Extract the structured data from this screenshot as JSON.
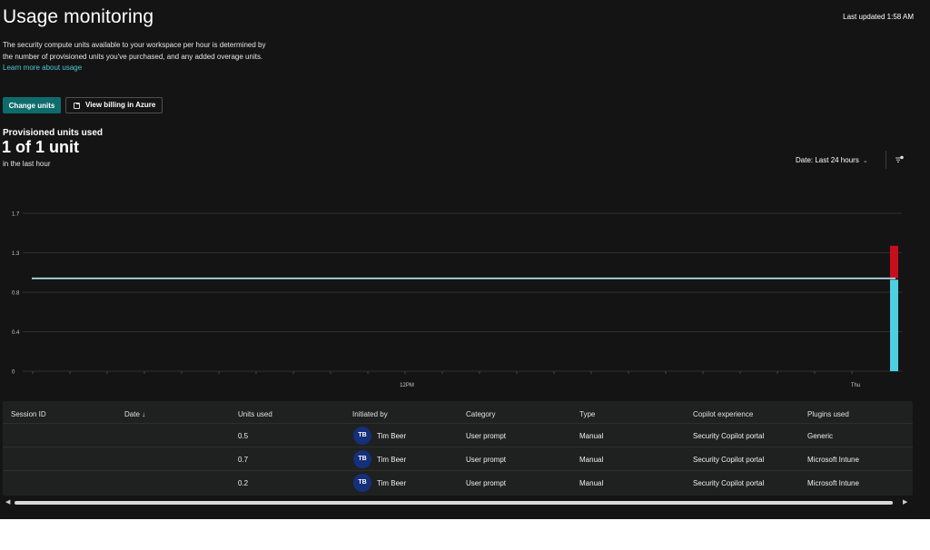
{
  "header": {
    "title": "Usage monitoring",
    "last_updated": "Last updated 1:58 AM"
  },
  "description": {
    "text": "The security compute units available to your workspace per hour is determined by the number of provisioned units you've purchased, and any added overage units.",
    "link": "Learn more about usage"
  },
  "actions": {
    "change_units": "Change units",
    "view_billing": "View billing in Azure"
  },
  "provisioned": {
    "label": "Provisioned units used",
    "value": "1 of 1 unit",
    "sub": "in the last hour"
  },
  "filters": {
    "date": "Date: Last 24 hours",
    "filter_icon": "filter-icon"
  },
  "chart_data": {
    "type": "bar",
    "y_ticks": [
      "1.7",
      "1.3",
      "0.8",
      "0.4",
      "0"
    ],
    "ylim": [
      0,
      1.7
    ],
    "x_tick_labels": [
      "12PM",
      "Thu"
    ],
    "threshold_line": {
      "value": 1,
      "color": "#c4f0f4"
    },
    "series": [
      {
        "name": "",
        "color": "#4dd0e1",
        "values": [
          1
        ]
      },
      {
        "name": "",
        "color": "#c50f1f",
        "values": [
          0.35
        ]
      }
    ],
    "grid": true
  },
  "table": {
    "columns": [
      "Session ID",
      "Date",
      "Units used",
      "Initiated by",
      "Category",
      "Type",
      "Copilot experience",
      "Plugins used"
    ],
    "sort_indicator": "↓",
    "rows": [
      {
        "session_id": "",
        "date": "",
        "units": "0.5",
        "initials": "TB",
        "user": "Tim Beer",
        "category": "User prompt",
        "type": "Manual",
        "experience": "Security Copilot portal",
        "plugins": "Generic"
      },
      {
        "session_id": "",
        "date": "",
        "units": "0.7",
        "initials": "TB",
        "user": "Tim Beer",
        "category": "User prompt",
        "type": "Manual",
        "experience": "Security Copilot portal",
        "plugins": "Microsoft Intune"
      },
      {
        "session_id": "",
        "date": "",
        "units": "0.2",
        "initials": "TB",
        "user": "Tim Beer",
        "category": "User prompt",
        "type": "Manual",
        "experience": "Security Copilot portal",
        "plugins": "Microsoft Intune"
      }
    ]
  },
  "colors": {
    "background": "#141414",
    "accent": "#0f6c6c",
    "link": "#4cc9d6",
    "avatar": "#15307a"
  }
}
